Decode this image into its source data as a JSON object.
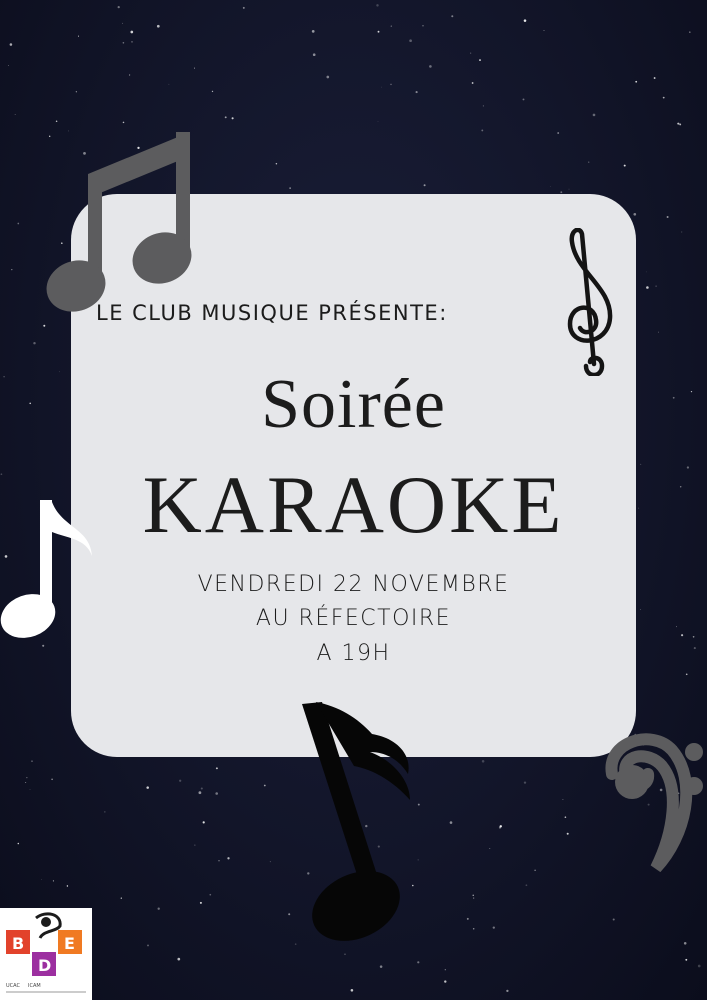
{
  "poster": {
    "presents": "LE CLUB MUSIQUE PRÉSENTE:",
    "title_line1": "Soirée",
    "title_line2": "KARAOKE",
    "date": "VENDREDI 22 NOVEMBRE",
    "place": "AU RÉFECTOIRE",
    "time": "A 19H"
  },
  "logo": {
    "letters": [
      "B",
      "D",
      "E"
    ],
    "small_text": [
      "UCAC",
      "ICAM"
    ]
  },
  "colors": {
    "background": "#121529",
    "card": "#e6e7ea",
    "note_gray": "#5c5c5e",
    "note_white": "#ffffff",
    "note_black": "#060606",
    "text": "#1c1c1c",
    "logo_red": "#e2422b",
    "logo_purple": "#9c2fa0",
    "logo_orange": "#f07a22"
  },
  "icons": [
    "beamed-eighth-notes-icon",
    "treble-clef-icon",
    "eighth-note-icon",
    "bass-clef-icon",
    "stylized-note-icon"
  ]
}
